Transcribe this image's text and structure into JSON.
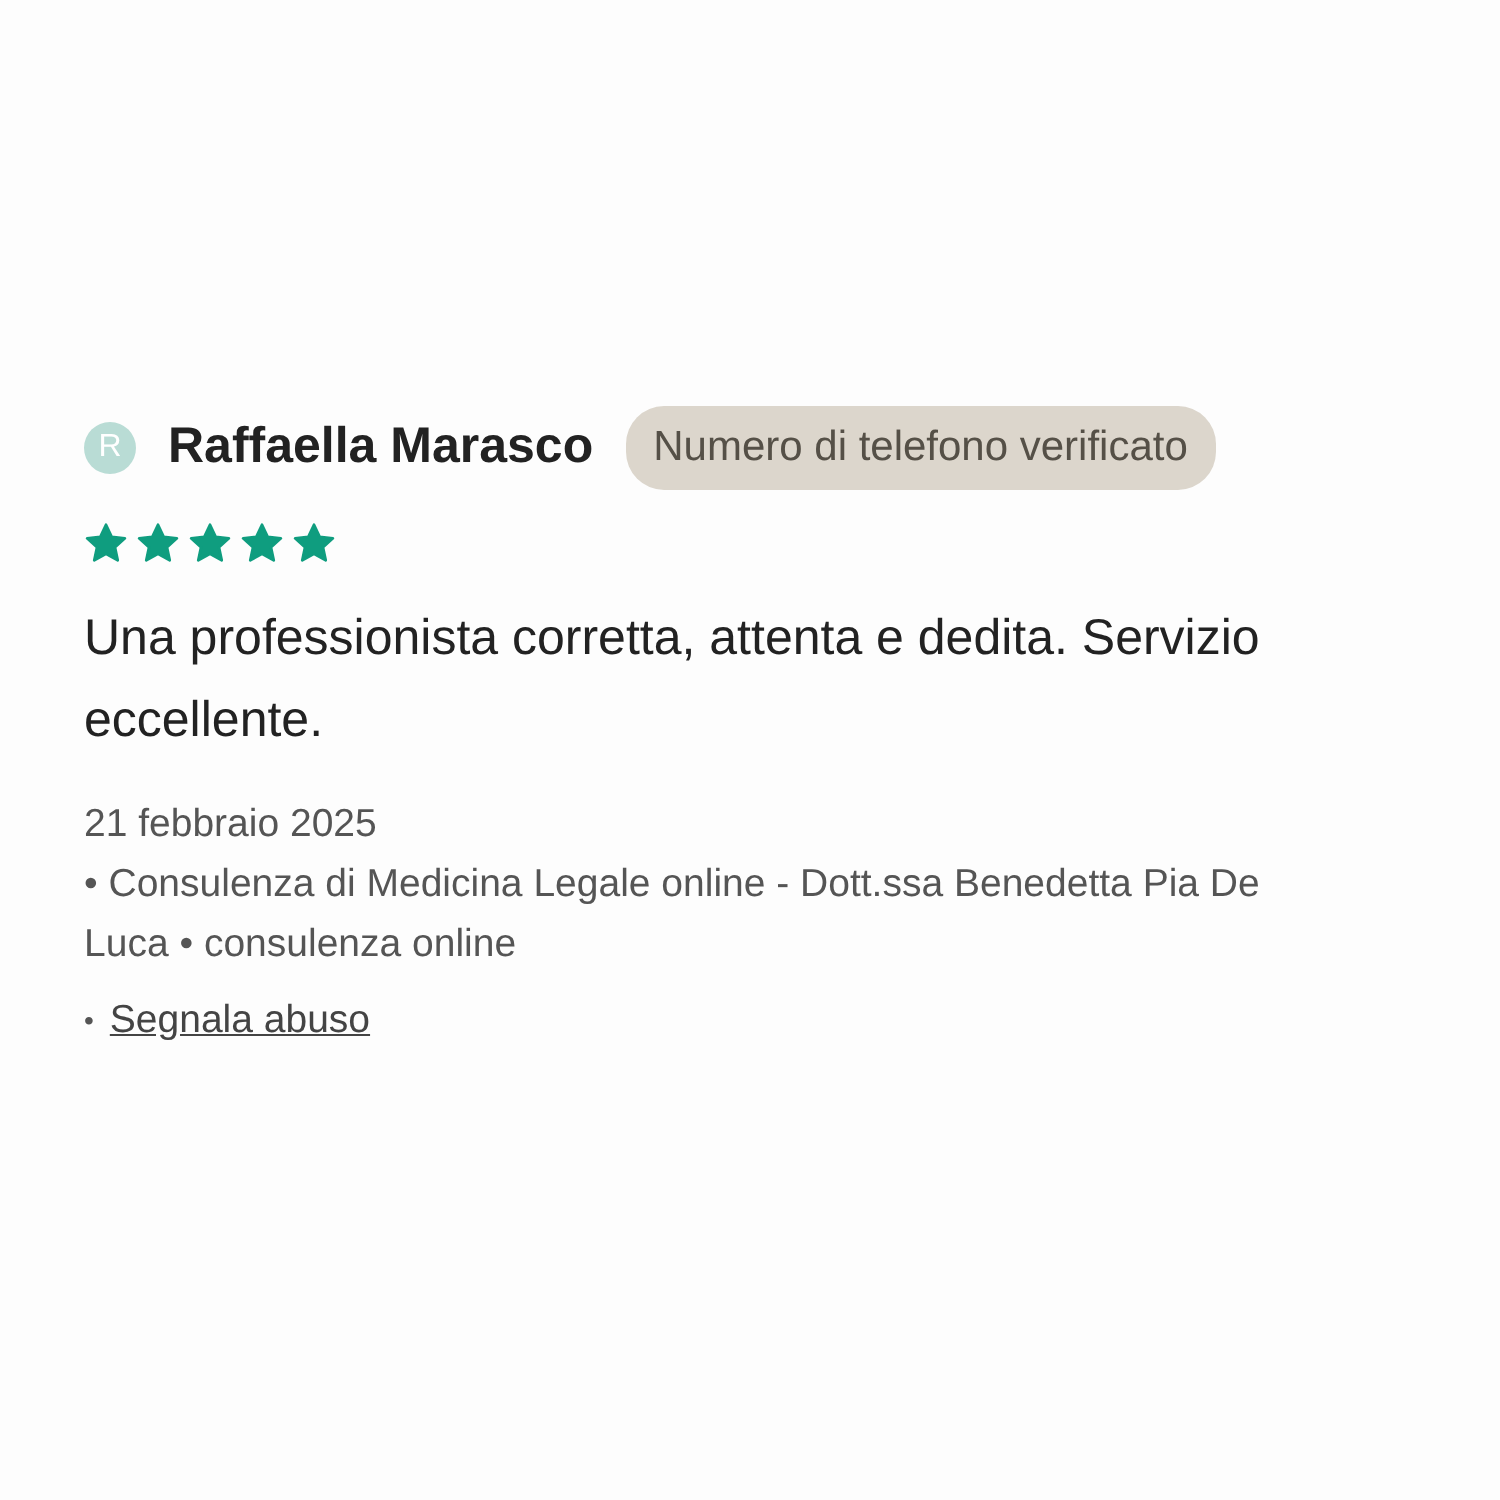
{
  "review": {
    "avatar_letter": "R",
    "author": "Raffaella Marasco",
    "badge": "Numero di telefono verificato",
    "stars": 5,
    "text": "Una professionista corretta, attenta e dedita. Servizio eccellente.",
    "date": "21 febbraio 2025",
    "details": "• Consulenza di Medicina Legale online - Dott.ssa Benedetta Pia De Luca • consulenza online",
    "report_bullet": "•",
    "report_link": "Segnala abuso"
  }
}
